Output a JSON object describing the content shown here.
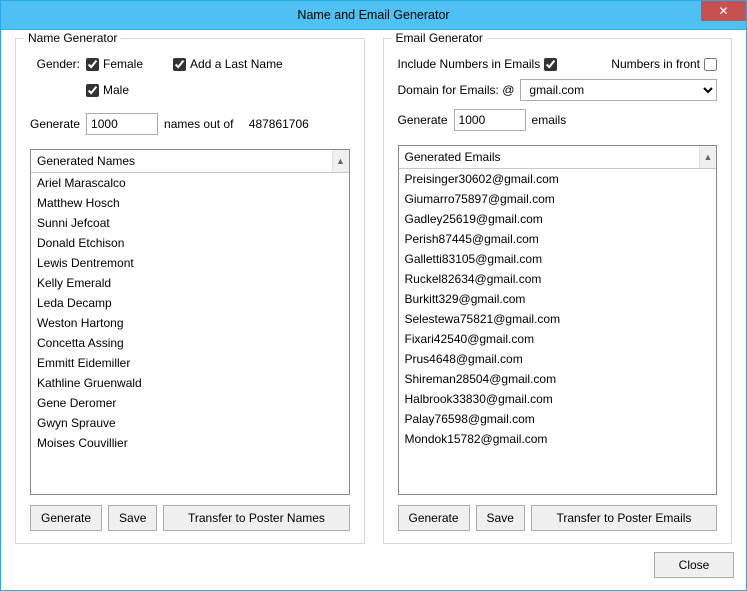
{
  "window": {
    "title": "Name and Email Generator",
    "close_btn": "✕"
  },
  "nameGen": {
    "legend": "Name Generator",
    "gender_label": "Gender:",
    "female_label": "Female",
    "male_label": "Male",
    "add_last_name_label": "Add a Last Name",
    "female_checked": true,
    "male_checked": true,
    "add_last_name_checked": true,
    "generate_label": "Generate",
    "generate_value": "1000",
    "out_of_label": "names out of",
    "out_of_count": "487861706",
    "list_header": "Generated Names",
    "items": [
      "Ariel Marascalco",
      "Matthew Hosch",
      "Sunni Jefcoat",
      "Donald Etchison",
      "Lewis Dentremont",
      "Kelly Emerald",
      "Leda Decamp",
      "Weston Hartong",
      "Concetta Assing",
      "Emmitt Eidemiller",
      "Kathline Gruenwald",
      "Gene Deromer",
      "Gwyn Sprauve",
      "Moises Couvillier"
    ],
    "btn_generate": "Generate",
    "btn_save": "Save",
    "btn_transfer": "Transfer to Poster Names"
  },
  "emailGen": {
    "legend": "Email Generator",
    "include_numbers_label": "Include Numbers in Emails",
    "include_numbers_checked": true,
    "numbers_in_front_label": "Numbers in front",
    "numbers_in_front_checked": false,
    "domain_label": "Domain for Emails: @",
    "domain_value": "gmail.com",
    "generate_label": "Generate",
    "generate_value": "1000",
    "emails_label": "emails",
    "list_header": "Generated Emails",
    "items": [
      "Preisinger30602@gmail.com",
      "Giumarro75897@gmail.com",
      "Gadley25619@gmail.com",
      "Perish87445@gmail.com",
      "Galletti83105@gmail.com",
      "Ruckel82634@gmail.com",
      "Burkitt329@gmail.com",
      "Selestewa75821@gmail.com",
      "Fixari42540@gmail.com",
      "Prus4648@gmail.com",
      "Shireman28504@gmail.com",
      "Halbrook33830@gmail.com",
      "Palay76598@gmail.com",
      "Mondok15782@gmail.com"
    ],
    "btn_generate": "Generate",
    "btn_save": "Save",
    "btn_transfer": "Transfer to Poster Emails"
  },
  "footer": {
    "close_btn": "Close"
  }
}
